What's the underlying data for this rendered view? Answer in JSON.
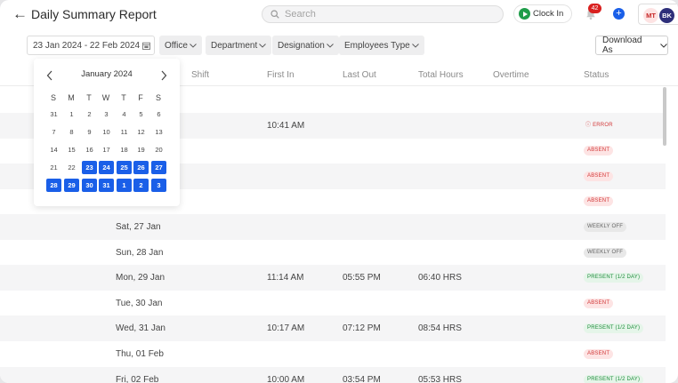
{
  "header": {
    "title": "Daily Summary Report",
    "search_placeholder": "Search",
    "clock_in_label": "Clock In",
    "notification_count": "42",
    "avatars": [
      "MT",
      "BK"
    ]
  },
  "filters": {
    "date_range": "23 Jan 2024 - 22 Feb 2024",
    "office": "Office",
    "department": "Department",
    "designation": "Designation",
    "employees_type": "Employees Type",
    "download_label": "Download As"
  },
  "calendar": {
    "month": "January 2024",
    "weekdays": [
      "S",
      "M",
      "T",
      "W",
      "T",
      "F",
      "S"
    ],
    "weeks": [
      [
        "31",
        "1",
        "2",
        "3",
        "4",
        "5",
        "6"
      ],
      [
        "7",
        "8",
        "9",
        "10",
        "11",
        "12",
        "13"
      ],
      [
        "14",
        "15",
        "16",
        "17",
        "18",
        "19",
        "20"
      ],
      [
        "21",
        "22",
        "23",
        "24",
        "25",
        "26",
        "27"
      ],
      [
        "28",
        "29",
        "30",
        "31",
        "1",
        "2",
        "3"
      ]
    ],
    "selected": [
      [
        3,
        2
      ],
      [
        3,
        3
      ],
      [
        3,
        4
      ],
      [
        3,
        5
      ],
      [
        3,
        6
      ],
      [
        4,
        0
      ],
      [
        4,
        1
      ],
      [
        4,
        2
      ],
      [
        4,
        3
      ],
      [
        4,
        4
      ],
      [
        4,
        5
      ],
      [
        4,
        6
      ]
    ]
  },
  "table": {
    "columns": [
      "Shift",
      "First In",
      "Last Out",
      "Total Hours",
      "Overtime",
      "Status"
    ],
    "rows": [
      {
        "date": "",
        "shift": "",
        "first_in": "",
        "last_out": "",
        "total_hours": "",
        "overtime": "",
        "status": "",
        "status_type": ""
      },
      {
        "date": "",
        "shift": "",
        "first_in": "10:41 AM",
        "last_out": "",
        "total_hours": "",
        "overtime": "",
        "status": "ⓘ ERROR",
        "status_type": "error"
      },
      {
        "date": "",
        "shift": "",
        "first_in": "",
        "last_out": "",
        "total_hours": "",
        "overtime": "",
        "status": "ABSENT",
        "status_type": "absent"
      },
      {
        "date": "",
        "shift": "",
        "first_in": "",
        "last_out": "",
        "total_hours": "",
        "overtime": "",
        "status": "ABSENT",
        "status_type": "absent"
      },
      {
        "date": "",
        "shift": "",
        "first_in": "",
        "last_out": "",
        "total_hours": "",
        "overtime": "",
        "status": "ABSENT",
        "status_type": "absent"
      },
      {
        "date": "Sat, 27 Jan",
        "shift": "",
        "first_in": "",
        "last_out": "",
        "total_hours": "",
        "overtime": "",
        "status": "WEEKLY OFF",
        "status_type": "weekly"
      },
      {
        "date": "Sun, 28 Jan",
        "shift": "",
        "first_in": "",
        "last_out": "",
        "total_hours": "",
        "overtime": "",
        "status": "WEEKLY OFF",
        "status_type": "weekly"
      },
      {
        "date": "Mon, 29 Jan",
        "shift": "",
        "first_in": "11:14 AM",
        "last_out": "05:55 PM",
        "total_hours": "06:40 HRS",
        "overtime": "",
        "status": "PRESENT (1/2 DAY)",
        "status_type": "present"
      },
      {
        "date": "Tue, 30 Jan",
        "shift": "",
        "first_in": "",
        "last_out": "",
        "total_hours": "",
        "overtime": "",
        "status": "ABSENT",
        "status_type": "absent"
      },
      {
        "date": "Wed, 31 Jan",
        "shift": "",
        "first_in": "10:17 AM",
        "last_out": "07:12 PM",
        "total_hours": "08:54 HRS",
        "overtime": "",
        "status": "PRESENT (1/2 DAY)",
        "status_type": "present"
      },
      {
        "date": "Thu, 01 Feb",
        "shift": "",
        "first_in": "",
        "last_out": "",
        "total_hours": "",
        "overtime": "",
        "status": "ABSENT",
        "status_type": "absent"
      },
      {
        "date": "Fri, 02 Feb",
        "shift": "",
        "first_in": "10:00 AM",
        "last_out": "03:54 PM",
        "total_hours": "05:53 HRS",
        "overtime": "",
        "status": "PRESENT (1/2 DAY)",
        "status_type": "present"
      }
    ]
  },
  "colors": {
    "accent": "#1a5fe8",
    "clock_in_green": "#1f9d4a",
    "badge_red": "#d9201f",
    "row_shade": "#f5f5f6"
  }
}
